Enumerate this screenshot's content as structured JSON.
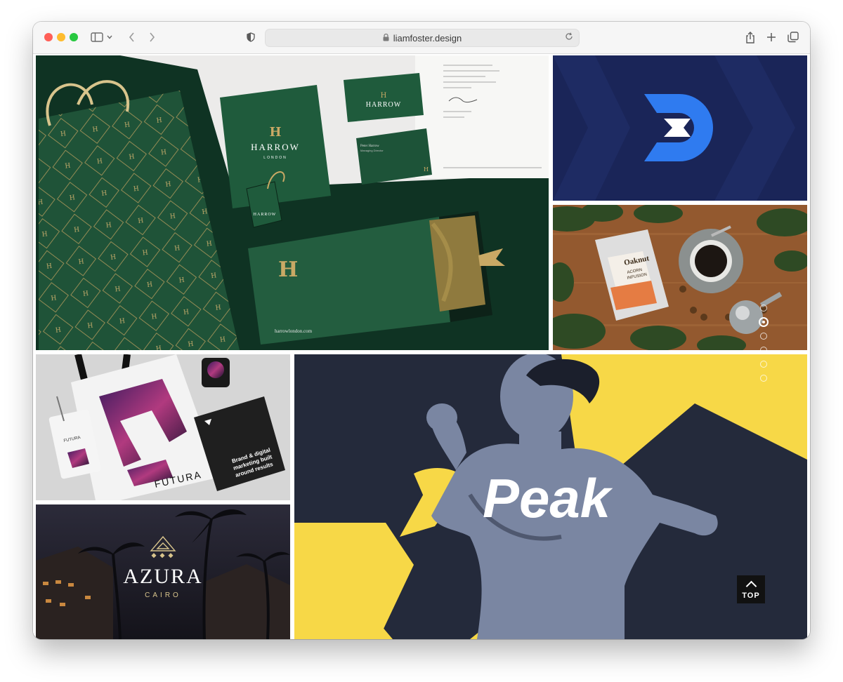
{
  "browser": {
    "url": "liamfoster.design",
    "colors": {
      "close": "#ff5f57",
      "minimize": "#febc2e",
      "zoom": "#28c840"
    }
  },
  "portfolio": {
    "harrow": {
      "brand": "HARROW",
      "sub": "LONDON",
      "monogram": "H",
      "website": "harrowlondon.com",
      "card_name": "Peter Harrow",
      "card_role": "Managing Director"
    },
    "drift": {
      "colors": {
        "bg": "#1a2558",
        "logo": "#2f7bf0"
      }
    },
    "oaknut": {
      "brand": "Oaknut",
      "product_line1": "ACORN",
      "product_line2": "INFUSION"
    },
    "futura": {
      "brand": "FUTURA",
      "tagline_line1": "Brand & digital",
      "tagline_line2": "marketing built",
      "tagline_line3": "around results"
    },
    "azura": {
      "brand": "AZURA",
      "city": "CAIRO"
    },
    "peak": {
      "brand": "Peak",
      "colors": {
        "navy": "#242a3b",
        "yellow": "#f7d847"
      }
    }
  },
  "slider": {
    "count": 6,
    "active_index": 1
  },
  "top_button": {
    "label": "TOP"
  }
}
